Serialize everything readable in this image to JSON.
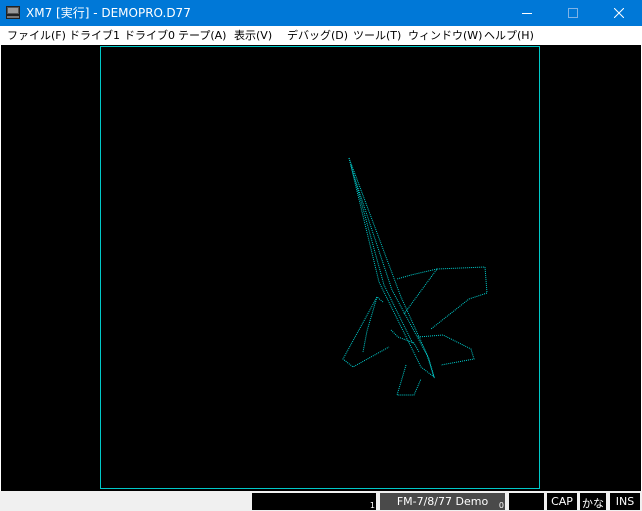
{
  "window": {
    "title": "XM7 [実行] - DEMOPRO.D77",
    "app_icon": "computer-icon",
    "controls": [
      "minimize-icon",
      "maximize-icon",
      "close-icon"
    ]
  },
  "menubar": {
    "items": [
      {
        "label": "ファイル(F)"
      },
      {
        "label": "ドライブ1"
      },
      {
        "label": "ドライブ0"
      },
      {
        "label": "テープ(A)"
      },
      {
        "label": "表示(V)"
      },
      {
        "label": "デバッグ(D)"
      },
      {
        "label": "ツール(T)"
      },
      {
        "label": "ウィンドウ(W)"
      },
      {
        "label": "ヘルプ(H)"
      }
    ]
  },
  "screen": {
    "content": "wireframe jet fighter",
    "line_color": "#00d0d0",
    "border_color": "#00c8c8"
  },
  "statusbar": {
    "fdd1_text": "",
    "fdd1_number": "1",
    "fdd0_text": "FM-7/8/77 Demo",
    "fdd0_number": "0",
    "tape_text": "",
    "cap": "CAP",
    "kana": "かな",
    "ins": "INS"
  }
}
